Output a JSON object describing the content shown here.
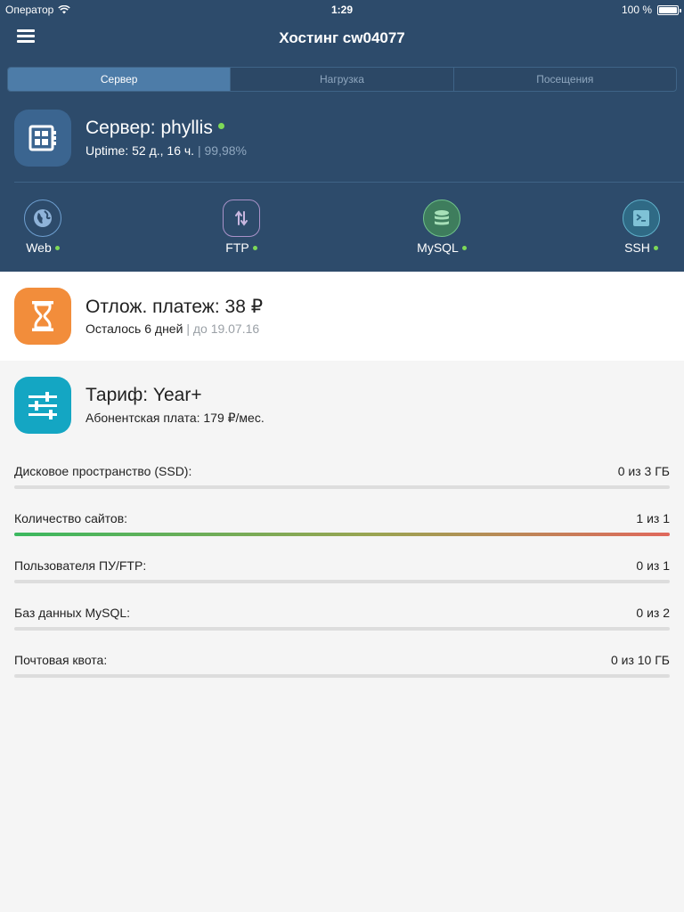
{
  "status_bar": {
    "carrier": "Оператор",
    "time": "1:29",
    "battery": "100 %"
  },
  "nav": {
    "title": "Хостинг cw04077"
  },
  "tabs": [
    {
      "label": "Сервер",
      "active": true
    },
    {
      "label": "Нагрузка",
      "active": false
    },
    {
      "label": "Посещения",
      "active": false
    }
  ],
  "server": {
    "title": "Сервер: phyllis",
    "uptime": "Uptime: 52 д., 16 ч.",
    "uptime_percent": "99,98%",
    "online": true
  },
  "services": [
    {
      "label": "Web",
      "icon": "globe-icon",
      "online": true
    },
    {
      "label": "FTP",
      "icon": "transfer-arrows-icon",
      "online": true
    },
    {
      "label": "MySQL",
      "icon": "database-icon",
      "online": true
    },
    {
      "label": "SSH",
      "icon": "terminal-icon",
      "online": true
    }
  ],
  "payment": {
    "title": "Отлож. платеж: 38 ₽",
    "remaining": "Осталось 6 дней",
    "until": "до 19.07.16"
  },
  "tariff": {
    "title": "Тариф: Year+",
    "fee": "Абонентская плата: 179 ₽/мес."
  },
  "quotas": [
    {
      "name": "Дисковое пространство (SSD):",
      "value": "0 из 3 ГБ",
      "fraction": 0
    },
    {
      "name": "Количество сайтов:",
      "value": "1 из 1",
      "fraction": 1
    },
    {
      "name": "Пользователя ПУ/FTP:",
      "value": "0 из 1",
      "fraction": 0
    },
    {
      "name": "Баз данных MySQL:",
      "value": "0 из 2",
      "fraction": 0
    },
    {
      "name": "Почтовая квота:",
      "value": "0 из 10 ГБ",
      "fraction": 0
    }
  ],
  "colors": {
    "header_bg": "#2d4b6b",
    "status_online": "#7ed957",
    "payment_icon": "#f28d3b",
    "tariff_icon": "#14a6c3",
    "active_tab": "#4d7ca8"
  }
}
